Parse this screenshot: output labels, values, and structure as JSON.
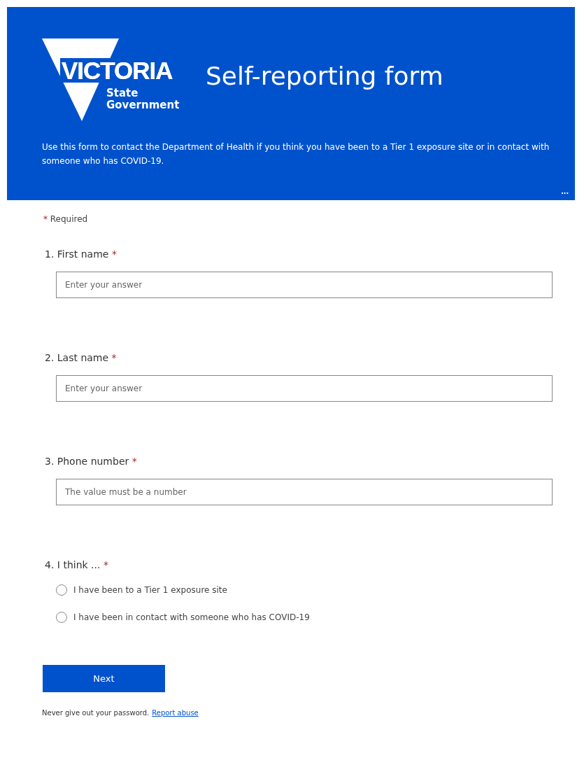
{
  "header": {
    "logo": {
      "wordmark": "VICTORIA",
      "subtitle_lines": [
        "State",
        "Government"
      ]
    },
    "title": "Self-reporting form",
    "description": "Use this form to contact the Department of Health if you think you have been to a Tier 1 exposure site or in contact with someone who has COVID-19.",
    "more_button": "..."
  },
  "required_note": {
    "mark": "*",
    "text": "Required"
  },
  "questions": [
    {
      "kind": "text",
      "number": "1.",
      "title": "First name",
      "required": true,
      "placeholder": "Enter your answer"
    },
    {
      "kind": "text",
      "number": "2.",
      "title": "Last name",
      "required": true,
      "placeholder": "Enter your answer"
    },
    {
      "kind": "text",
      "number": "3.",
      "title": "Phone number",
      "required": true,
      "placeholder": "The value must be a number"
    },
    {
      "kind": "choice",
      "number": "4.",
      "title": "I think ...",
      "required": true,
      "options": [
        {
          "label": "I have been to a Tier 1 exposure site",
          "selected": false
        },
        {
          "label": "I have been in contact with someone who has COVID-19",
          "selected": false
        }
      ]
    }
  ],
  "next_button": "Next",
  "footer": {
    "note": "Never give out your password.",
    "link": "Report abuse"
  }
}
